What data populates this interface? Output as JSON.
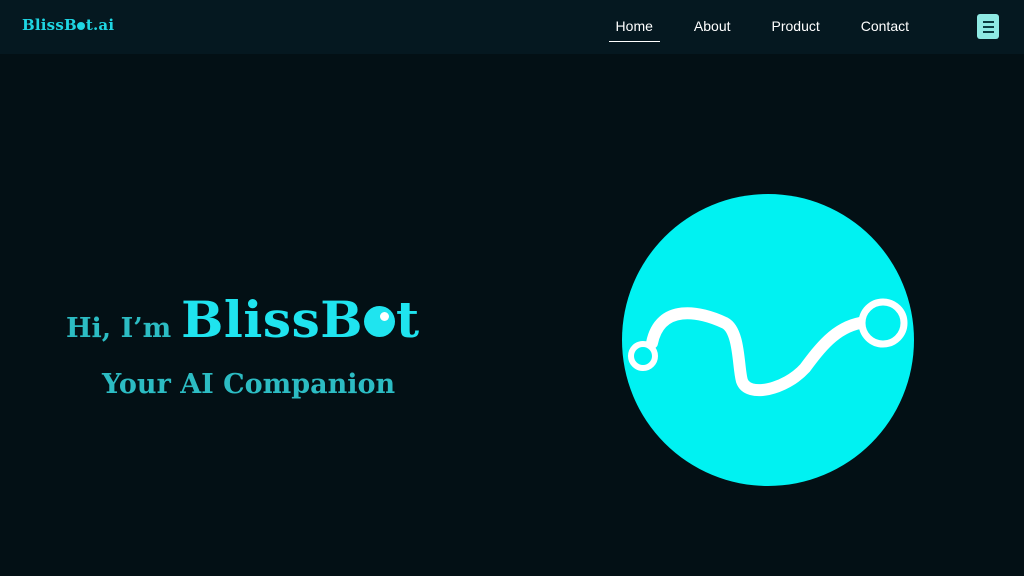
{
  "header": {
    "logo_before": "BlissB",
    "logo_after": "t.ai",
    "nav": [
      {
        "label": "Home",
        "active": true
      },
      {
        "label": "About",
        "active": false
      },
      {
        "label": "Product",
        "active": false
      },
      {
        "label": "Contact",
        "active": false
      }
    ],
    "menu_icon": "hamburger-icon"
  },
  "hero": {
    "greeting": "Hi, I’m",
    "name_before": "BlissB",
    "name_after": "t",
    "tagline": "Your AI Companion",
    "graphic_icon": "wave-circle-logo"
  },
  "colors": {
    "background": "#031015",
    "navbar": "#051820",
    "accent": "#1fe4ef",
    "text_teal": "#2cbcc3",
    "circle": "#00f2f2"
  }
}
